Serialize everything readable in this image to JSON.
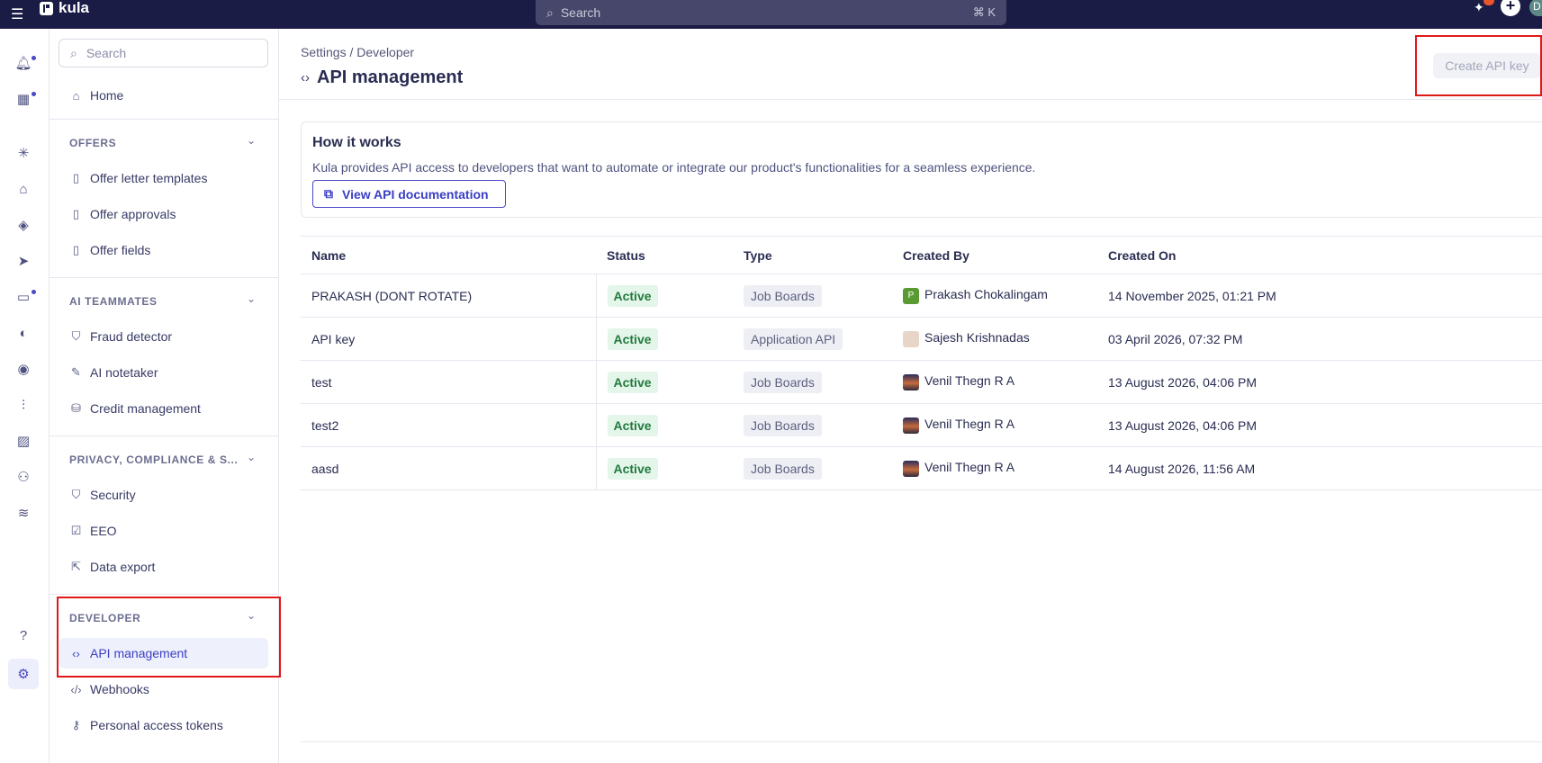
{
  "topbar": {
    "app_name": "kula",
    "search_placeholder": "Search",
    "search_shortcut": "⌘ K",
    "user_initial": "D"
  },
  "sidebar": {
    "search_placeholder": "Search",
    "home": "Home",
    "sections": {
      "offers": "OFFERS",
      "ai": "AI TEAMMATES",
      "privacy": "PRIVACY, COMPLIANCE & S...",
      "developer": "DEVELOPER"
    },
    "offers_items": [
      "Offer letter templates",
      "Offer approvals",
      "Offer fields"
    ],
    "ai_items": [
      "Fraud detector",
      "AI notetaker",
      "Credit management"
    ],
    "privacy_items": [
      "Security",
      "EEO",
      "Data export"
    ],
    "developer_items": [
      "API management",
      "Webhooks",
      "Personal access tokens"
    ]
  },
  "page": {
    "breadcrumb": "Settings / Developer",
    "title": "API management",
    "create_button": "Create API key"
  },
  "how_it_works": {
    "title": "How it works",
    "description": "Kula provides API access to developers that want to automate or integrate our product's functionalities for a seamless experience.",
    "doc_button": "View API documentation"
  },
  "table": {
    "columns": [
      "Name",
      "Status",
      "Type",
      "Created By",
      "Created On"
    ],
    "rows": [
      {
        "name": "PRAKASH (DONT ROTATE)",
        "status": "Active",
        "type": "Job Boards",
        "created_by": "Prakash Chokalingam",
        "avatar_letter": "P",
        "created_on": "14 November 2025, 01:21 PM"
      },
      {
        "name": "API key",
        "status": "Active",
        "type": "Application API",
        "created_by": "Sajesh Krishnadas",
        "avatar_letter": "",
        "created_on": "03 April 2026, 07:32 PM"
      },
      {
        "name": "test",
        "status": "Active",
        "type": "Job Boards",
        "created_by": "Venil Thegn R A",
        "avatar_letter": "",
        "created_on": "13 August 2026, 04:06 PM"
      },
      {
        "name": "test2",
        "status": "Active",
        "type": "Job Boards",
        "created_by": "Venil Thegn R A",
        "avatar_letter": "",
        "created_on": "13 August 2026, 04:06 PM"
      },
      {
        "name": "aasd",
        "status": "Active",
        "type": "Job Boards",
        "created_by": "Venil Thegn R A",
        "avatar_letter": "",
        "created_on": "14 August 2026, 11:56 AM"
      }
    ]
  }
}
